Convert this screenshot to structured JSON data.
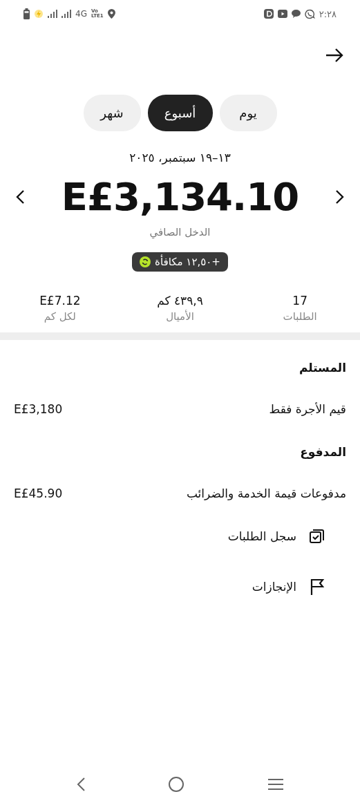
{
  "status_bar": {
    "time": "٢:٢٨",
    "network": "4G",
    "volte_top": "Vo",
    "volte_bottom": "LTE1"
  },
  "tabs": [
    {
      "label": "يوم",
      "selected": false
    },
    {
      "label": "أسبوع",
      "selected": true
    },
    {
      "label": "شهر",
      "selected": false
    }
  ],
  "date_range": "١٣–١٩ سبتمبر، ٢٠٢٥",
  "net_income": {
    "amount": "E£3,134.10",
    "label": "الدخل الصافي"
  },
  "bonus_badge": "+١٢,٥٠ مكافأة",
  "stats": [
    {
      "value": "17",
      "label": "الطلبات"
    },
    {
      "value": "٤٣٩,٩ كم",
      "label": "الأميال"
    },
    {
      "value": "E£7.12",
      "label": "لكل كم"
    }
  ],
  "sections": [
    {
      "title": "المستلم",
      "rows": [
        {
          "label": "قيم الأجرة فقط",
          "value": "E£3,180"
        }
      ]
    },
    {
      "title": "المدفوع",
      "rows": [
        {
          "label": "مدفوعات قيمة الخدمة والضرائب",
          "value": "E£45.90"
        }
      ]
    }
  ],
  "links": [
    {
      "kind": "orders",
      "label": "سجل الطلبات"
    },
    {
      "kind": "achievements",
      "label": "الإنجازات"
    }
  ]
}
